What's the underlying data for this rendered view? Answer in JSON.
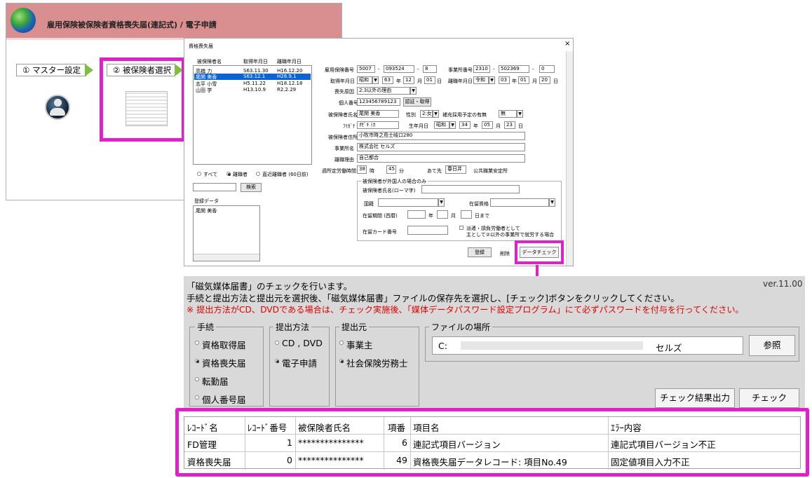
{
  "window1": {
    "title": "雇用保険被保険者資格喪失届(連記式) / 電子申請",
    "step1_label": "① マスター設定",
    "step2_label": "② 被保険者選択"
  },
  "dialog": {
    "title": "資格喪失届",
    "close_glyph": "×",
    "list_headers": [
      "被保険者名",
      "取得年月日",
      "離職年月日"
    ],
    "list_rows": [
      {
        "name": "高橋 力",
        "acq": "S63.11.30",
        "leave": "H16.12.20",
        "selected": false
      },
      {
        "name": "尾関 美香",
        "acq": "S63.12.1",
        "leave": "H28.9.1",
        "selected": true
      },
      {
        "name": "志平 小雪",
        "acq": "H5.11.22",
        "leave": "H18.12.18",
        "selected": false
      },
      {
        "name": "山田 学",
        "acq": "H13.10.9",
        "leave": "R2.2.29",
        "selected": false
      }
    ],
    "filter_all": "すべて",
    "filter_leavers": "離職者",
    "filter_recent": "直近離職者 (60日前)",
    "search_button": "検索",
    "registered_label": "登録データ",
    "registered_item": "尾関 美香",
    "insured_no_label": "雇用保険番号",
    "insured_no": [
      "5007",
      "093524",
      "8"
    ],
    "office_no_label": "事業所番号",
    "office_no": [
      "2310",
      "502369",
      "0"
    ],
    "acq_date_label": "取得年月日",
    "acq_era": "昭和",
    "acq_y": "63",
    "acq_m": "12",
    "acq_d": "01",
    "leave_date_label": "離職年月日",
    "leave_era": "令和",
    "leave_y": "03",
    "leave_m": "01",
    "leave_d": "20",
    "unit_year": "年",
    "unit_month": "月",
    "unit_day": "日",
    "loss_reason_label": "喪失原因",
    "loss_reason": "2:3以外の理由",
    "my_number_label": "個人番号",
    "my_number": "123456789123",
    "auth_button": "認証・取得",
    "name_label": "被保険者氏名",
    "name_value": "尾関 美香",
    "gender_label": "性別",
    "gender_value": "2:女",
    "supplement_label": "補充採用予定の有無",
    "supplement_value": "無",
    "kana_label": "ﾌﾘｶﾞﾅ",
    "kana_value": "ｵｾﾞｷ ﾐｶ",
    "birth_label": "生年月日",
    "birth_era": "昭和",
    "birth_y": "34",
    "birth_m": "05",
    "birth_d": "23",
    "address_label": "被保険者住所",
    "address_value": "小牧市時之島士岐口280",
    "office_name_label": "事業所名",
    "office_name_value": "株式会社 セルズ",
    "leave_reason_label": "離職理由",
    "leave_reason_value": "自己都合",
    "hours_label": "週所定労働時間",
    "hours_h": "38",
    "hours_unit_h": "時",
    "hours_m": "45",
    "hours_unit_m": "分",
    "dest_label": "あて先",
    "dest_value": "春日井",
    "dest_suffix": "公共職業安定所",
    "foreign_group": "被保険者が外国人の場合のみ",
    "romaji_label": "被保険者氏名(ローマ字)",
    "nationality_label": "国籍",
    "status_label": "在留資格",
    "period_label": "在留期間 (西暦)",
    "period_year": "年",
    "period_month": "月",
    "period_until": "日まで",
    "card_label": "在留カード番号",
    "dispatch_line1": "派遣・請負労働者として",
    "dispatch_line2": "主として②以外の事業所で就労する場合",
    "register_button": "登録",
    "delete_button": "削除",
    "datacheck_button": "データチェック"
  },
  "checker": {
    "line1": "「磁気媒体届書」のチェックを行います。",
    "line2": "手続と提出方法と提出元を選択後、「磁気媒体届書」ファイルの保存先を選択し、[チェック]ボタンをクリックしてください。",
    "line3": "※ 提出方法がCD、DVDである場合は、チェック実施後、「媒体データパスワード設定プログラム」にて必ずパスワードを付与を行ってください。",
    "version": "ver.11.00",
    "group_procedure": "手続",
    "procedures": [
      {
        "label": "資格取得届",
        "checked": false
      },
      {
        "label": "資格喪失届",
        "checked": true
      },
      {
        "label": "転勤届",
        "checked": false
      },
      {
        "label": "個人番号届",
        "checked": false
      }
    ],
    "group_method": "提出方法",
    "methods": [
      {
        "label": "CD , DVD",
        "checked": false
      },
      {
        "label": "電子申請",
        "checked": true
      }
    ],
    "group_source": "提出元",
    "sources": [
      {
        "label": "事業主",
        "checked": false
      },
      {
        "label": "社会保険労務士",
        "checked": true
      }
    ],
    "group_file": "ファイルの場所",
    "file_path_start": "C:",
    "file_path_end": "セルズ",
    "browse_button": "参照",
    "output_button": "チェック結果出力",
    "check_button": "チェック"
  },
  "results": {
    "headers": [
      "ﾚｺｰﾄﾞ名",
      "ﾚｺｰﾄﾞ番号",
      "被保険者氏名",
      "項番",
      "項目名",
      "ｴﾗｰ内容"
    ],
    "rows": [
      [
        "FD管理",
        "1",
        "***************",
        "6",
        "連記式項目バージョン",
        "連記式項目バージョン不正"
      ],
      [
        "資格喪失届",
        "0",
        "***************",
        "49",
        "資格喪失届データレコード: 項目No.49",
        "固定値項目入力不正"
      ]
    ]
  },
  "colors": {
    "highlight": "#e020c8",
    "title_band": "#d98f8f",
    "step_chevron": "#7cc040",
    "warning_text": "#e00000",
    "selected_row": "#0a64d6"
  }
}
